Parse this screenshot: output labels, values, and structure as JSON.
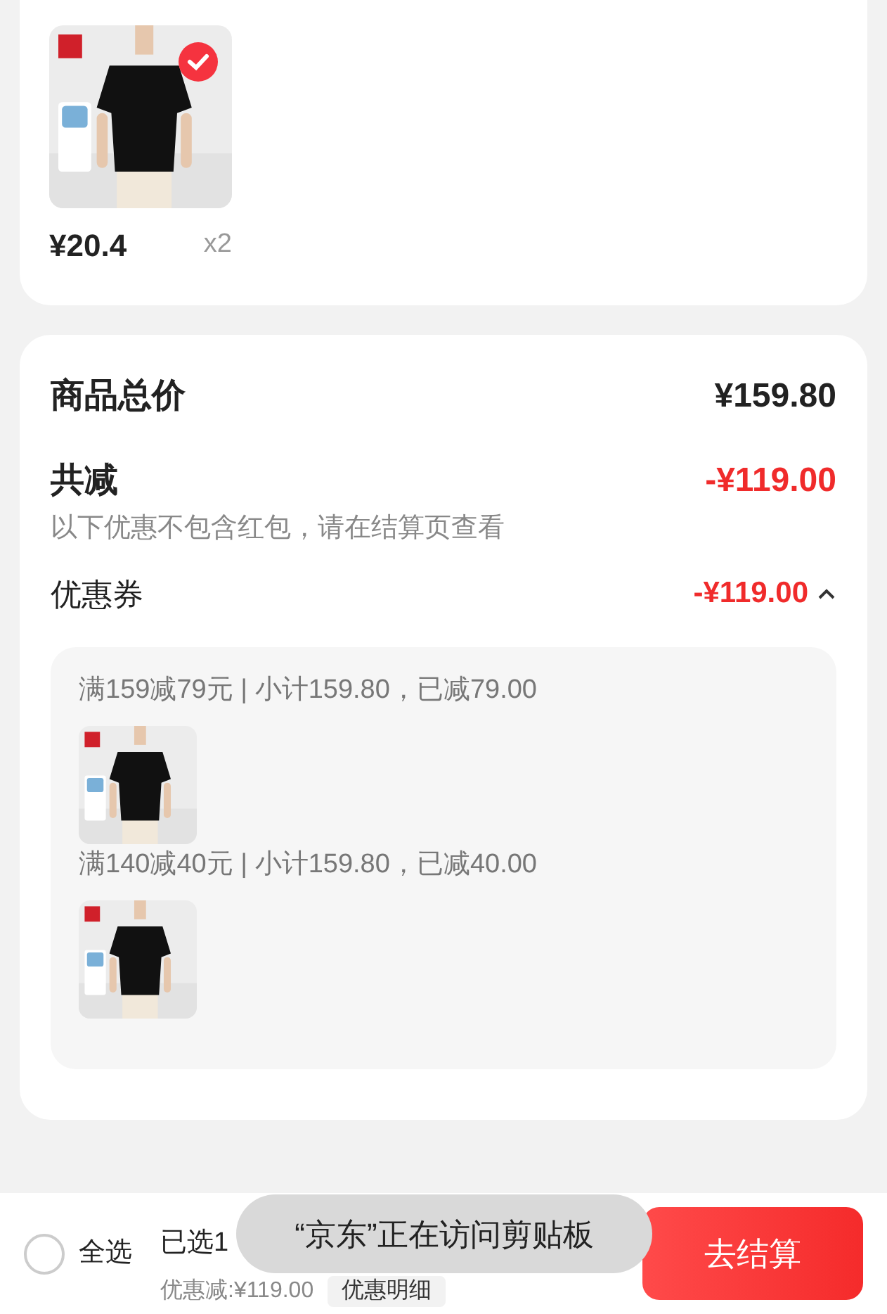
{
  "product": {
    "kind": "picture",
    "selected": true,
    "price": "¥20.4",
    "quantity": "x2"
  },
  "summary": {
    "total_label": "商品总价",
    "total_value": "¥159.80",
    "discount_label": "共减",
    "discount_value": "-¥119.00",
    "note": "以下优惠不包含红包，请在结算页查看"
  },
  "coupon": {
    "label": "优惠券",
    "value": "-¥119.00",
    "expanded": true,
    "groups": [
      {
        "title": "满159减79元 | 小计159.80，已减79.00"
      },
      {
        "title": "满140减40元 | 小计159.80，已减40.00"
      }
    ]
  },
  "bottom_bar": {
    "select_all": {
      "label": "全选",
      "checked": false
    },
    "selected_count": "已选1",
    "discount": "优惠减:¥119.00",
    "detail_button": "优惠明细",
    "checkout_button": "去结算"
  },
  "toast": "“京东”正在访问剪贴板"
}
